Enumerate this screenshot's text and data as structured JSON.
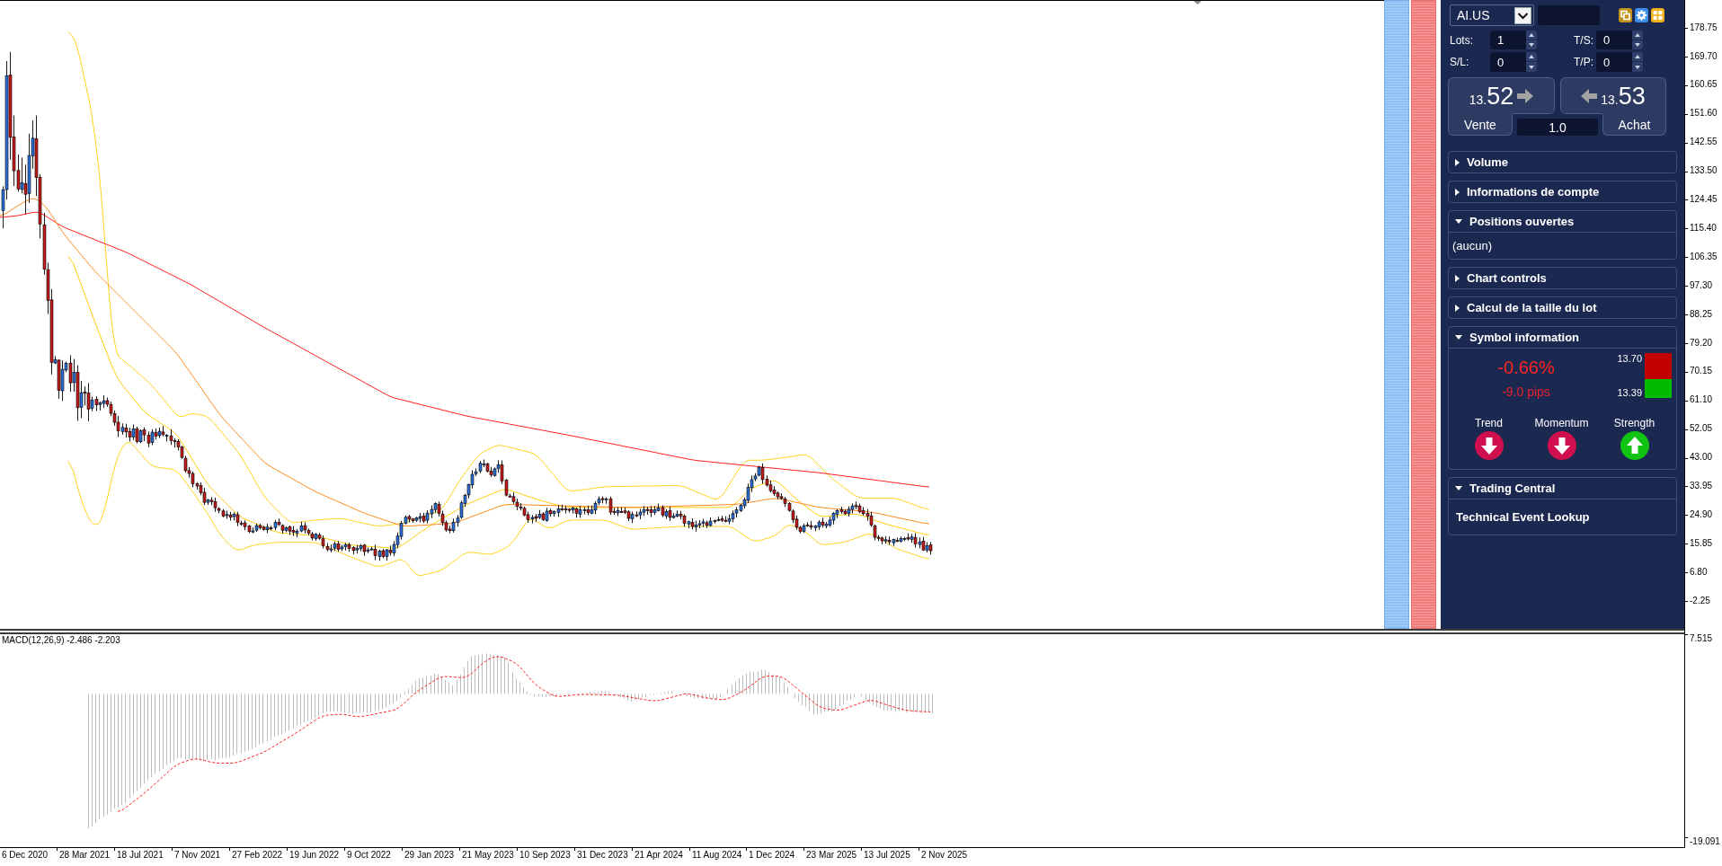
{
  "chart": {
    "price_axis_labels": [
      "178.75",
      "169.70",
      "160.65",
      "151.60",
      "142.55",
      "133.50",
      "124.45",
      "115.40",
      "106.35",
      "97.30",
      "88.25",
      "79.20",
      "70.15",
      "61.10",
      "52.05",
      "43.00",
      "33.95",
      "24.90",
      "15.85",
      "6.80",
      "-2.25"
    ]
  },
  "macd": {
    "label": "MACD(12,26,9) -2.486 -2.203",
    "axis_labels": [
      "7.515",
      "-19.091"
    ]
  },
  "time_axis": {
    "labels": [
      "6 Dec 2020",
      "28 Mar 2021",
      "18 Jul 2021",
      "7 Nov 2021",
      "27 Feb 2022",
      "19 Jun 2022",
      "9 Oct 2022",
      "29 Jan 2023",
      "21 May 2023",
      "10 Sep 2023",
      "31 Dec 2023",
      "21 Apr 2024",
      "11 Aug 2024",
      "1 Dec 2024",
      "23 Mar 2025",
      "13 Jul 2025",
      "2 Nov 2025"
    ]
  },
  "panel": {
    "symbol": "AI.US",
    "fields": [
      {
        "label": "Lots:",
        "value": "1"
      },
      {
        "label": "T/S:",
        "value": "0"
      },
      {
        "label": "S/L:",
        "value": "0"
      },
      {
        "label": "T/P:",
        "value": "0"
      }
    ],
    "sell": {
      "price_prefix": "13.",
      "price_pips": "52",
      "label": "Vente"
    },
    "buy": {
      "price_prefix": "13.",
      "price_pips": "53",
      "label": "Achat"
    },
    "lot_size": "1.0",
    "sections": [
      {
        "title": "Volume",
        "expanded": false
      },
      {
        "title": "Informations de compte",
        "expanded": false
      },
      {
        "title": "Positions ouvertes",
        "expanded": true,
        "body": {
          "kind": "text",
          "text": "(aucun)"
        }
      },
      {
        "title": "Chart controls",
        "expanded": false
      },
      {
        "title": "Calcul de la taille du lot",
        "expanded": false
      },
      {
        "title": "Symbol information",
        "expanded": true,
        "body": {
          "kind": "symbol_info",
          "change": "-0.66%",
          "pips": "-9.0 pips",
          "high": "13.70",
          "low": "13.39",
          "indicators": [
            {
              "label": "Trend",
              "kind": "down"
            },
            {
              "label": "Momentum",
              "kind": "down"
            },
            {
              "label": "Strength",
              "kind": "up"
            }
          ]
        }
      },
      {
        "title": "Trading Central",
        "expanded": true,
        "body": {
          "kind": "link",
          "text": "Technical Event Lookup"
        }
      }
    ]
  }
}
